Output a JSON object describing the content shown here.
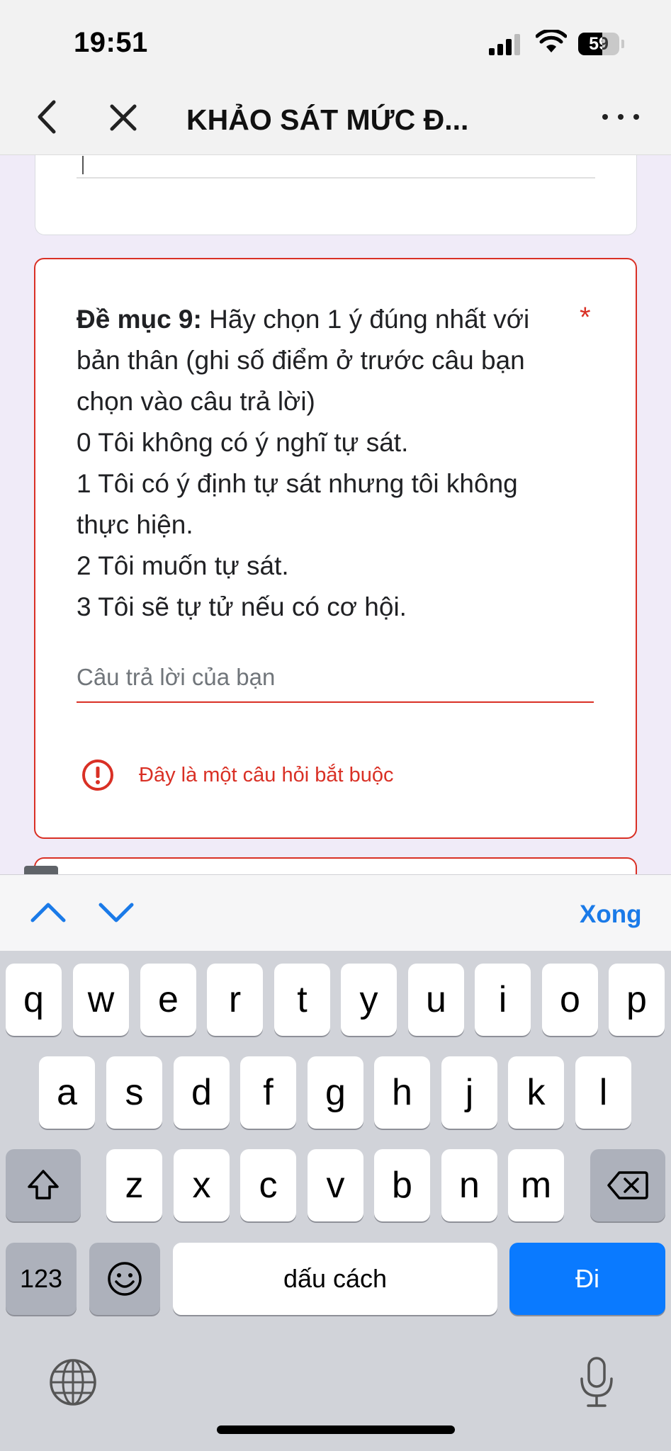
{
  "status_bar": {
    "time": "19:51",
    "battery": "59",
    "battery_level": 0.59
  },
  "nav": {
    "title": "KHẢO SÁT MỨC Đ..."
  },
  "question": {
    "heading": "Đề mục 9:",
    "text": " Hãy chọn 1 ý đúng nhất với bản thân (ghi số điểm ở trước câu bạn chọn vào câu trả lời)\n0 Tôi không có ý nghĩ tự sát.\n1 Tôi có ý định tự sát nhưng tôi không thực hiện.\n2 Tôi muốn tự sát.\n3 Tôi sẽ tự tử nếu có cơ hội.",
    "required_mark": "*",
    "answer_placeholder": "Câu trả lời của bạn",
    "answer_value": "",
    "error": "Đây là một câu hỏi bắt buộc"
  },
  "accessory": {
    "done_label": "Xong"
  },
  "keyboard": {
    "row1": [
      "q",
      "w",
      "e",
      "r",
      "t",
      "y",
      "u",
      "i",
      "o",
      "p"
    ],
    "row2": [
      "a",
      "s",
      "d",
      "f",
      "g",
      "h",
      "j",
      "k",
      "l"
    ],
    "row3": [
      "z",
      "x",
      "c",
      "v",
      "b",
      "n",
      "m"
    ],
    "numbers_label": "123",
    "space_label": "dấu cách",
    "return_label": "Đi"
  }
}
